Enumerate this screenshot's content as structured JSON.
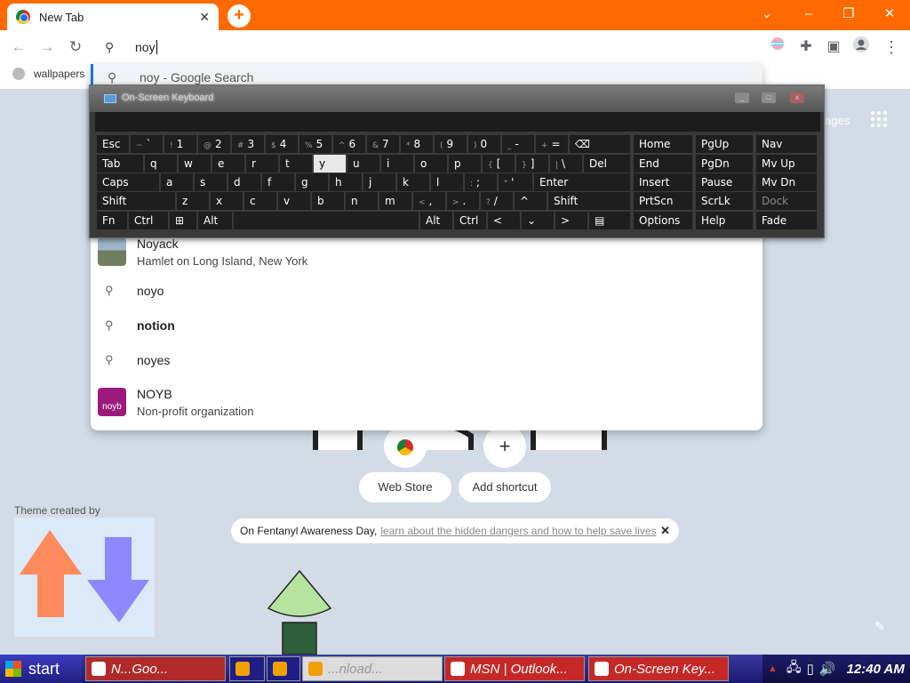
{
  "browser": {
    "tab_title": "New Tab",
    "tab_close": "✕",
    "new_tab": "+",
    "window_controls": {
      "dropdown": "⌄",
      "minimize": "–",
      "restore": "❐",
      "close": "✕"
    },
    "nav": {
      "back": "←",
      "forward": "→",
      "reload": "↻"
    },
    "omnibox_value": "noy",
    "toolbar_icons": [
      "profile-ring-icon",
      "extensions-icon",
      "side-panel-icon",
      "avatar-icon",
      "menu-icon"
    ],
    "accent": "#ff6a00"
  },
  "bookmarks": {
    "item": "wallpapers"
  },
  "suggestions": {
    "first": "noy - Google Search",
    "entity1": {
      "title": "Noyack",
      "subtitle": "Hamlet on Long Island, New York"
    },
    "rows": [
      "noyo",
      "notion",
      "noyes"
    ],
    "entity2": {
      "title": "NOYB",
      "subtitle": "Non-profit organization",
      "thumb_text": "noyb",
      "thumb_color": "#9c1a7c"
    }
  },
  "osk": {
    "title": "On-Screen Keyboard",
    "rows": [
      [
        {
          "l": "Esc"
        },
        {
          "s": "~",
          "l": "`"
        },
        {
          "s": "!",
          "l": "1"
        },
        {
          "s": "@",
          "l": "2"
        },
        {
          "s": "#",
          "l": "3"
        },
        {
          "s": "$",
          "l": "4"
        },
        {
          "s": "%",
          "l": "5"
        },
        {
          "s": "^",
          "l": "6"
        },
        {
          "s": "&",
          "l": "7"
        },
        {
          "s": "*",
          "l": "8"
        },
        {
          "s": "(",
          "l": "9"
        },
        {
          "s": ")",
          "l": "0"
        },
        {
          "s": "_",
          "l": "-"
        },
        {
          "s": "+",
          "l": "="
        },
        {
          "l": "⌫"
        }
      ],
      [
        {
          "l": "Tab"
        },
        {
          "l": "q"
        },
        {
          "l": "w"
        },
        {
          "l": "e"
        },
        {
          "l": "r"
        },
        {
          "l": "t"
        },
        {
          "l": "y",
          "active": true
        },
        {
          "l": "u"
        },
        {
          "l": "i"
        },
        {
          "l": "o"
        },
        {
          "l": "p"
        },
        {
          "s": "{",
          "l": "["
        },
        {
          "s": "}",
          "l": "]"
        },
        {
          "s": "|",
          "l": "\\"
        },
        {
          "l": "Del"
        }
      ],
      [
        {
          "l": "Caps"
        },
        {
          "l": "a"
        },
        {
          "l": "s"
        },
        {
          "l": "d"
        },
        {
          "l": "f"
        },
        {
          "l": "g"
        },
        {
          "l": "h"
        },
        {
          "l": "j"
        },
        {
          "l": "k"
        },
        {
          "l": "l"
        },
        {
          "s": ":",
          "l": ";"
        },
        {
          "s": "\"",
          "l": "'"
        },
        {
          "l": "Enter"
        }
      ],
      [
        {
          "l": "Shift"
        },
        {
          "l": "z"
        },
        {
          "l": "x"
        },
        {
          "l": "c"
        },
        {
          "l": "v"
        },
        {
          "l": "b"
        },
        {
          "l": "n"
        },
        {
          "l": "m"
        },
        {
          "s": "<",
          "l": ","
        },
        {
          "s": ">",
          "l": "."
        },
        {
          "s": "?",
          "l": "/"
        },
        {
          "l": "^"
        },
        {
          "l": "Shift"
        }
      ],
      [
        {
          "l": "Fn"
        },
        {
          "l": "Ctrl"
        },
        {
          "l": "⊞"
        },
        {
          "l": "Alt"
        },
        {
          "l": ""
        },
        {
          "l": "Alt"
        },
        {
          "l": "Ctrl"
        },
        {
          "l": "<"
        },
        {
          "l": "⌄"
        },
        {
          "l": ">"
        },
        {
          "l": "▤"
        }
      ]
    ],
    "nav_keys": [
      [
        "Home",
        "PgUp",
        "Nav"
      ],
      [
        "End",
        "PgDn",
        "Mv Up"
      ],
      [
        "Insert",
        "Pause",
        "Mv Dn"
      ],
      [
        "PrtScn",
        "ScrLk",
        "Dock"
      ],
      [
        "Options",
        "Help",
        "Fade"
      ]
    ]
  },
  "ntp": {
    "images_link": "ages",
    "shortcut_add": "+",
    "web_store": "Web Store",
    "add_shortcut": "Add shortcut",
    "theme_label": "Theme created by",
    "notice_text": "On Fentanyl Awareness Day,",
    "notice_link": "learn about the hidden dangers and how to help save lives",
    "notice_close": "✕"
  },
  "taskbar": {
    "start": "start",
    "buttons": [
      {
        "label": "N...Goo...",
        "icon": "chrome-icon",
        "color": "#c4302b"
      },
      {
        "label": "",
        "icon": "firefox-icon",
        "color": "#1a1a80"
      },
      {
        "label": "",
        "icon": "explorer-icon",
        "color": "#1a1a80"
      },
      {
        "label": "...nload...",
        "icon": "window-icon",
        "color": "#e8e8e8"
      },
      {
        "label": "MSN | Outlook...",
        "icon": "ie-icon",
        "color": "#c4302b"
      },
      {
        "label": "On-Screen Key...",
        "icon": "keyboard-icon",
        "color": "#c4302b"
      }
    ],
    "tray_up": "▲",
    "time": "12:40 AM"
  }
}
